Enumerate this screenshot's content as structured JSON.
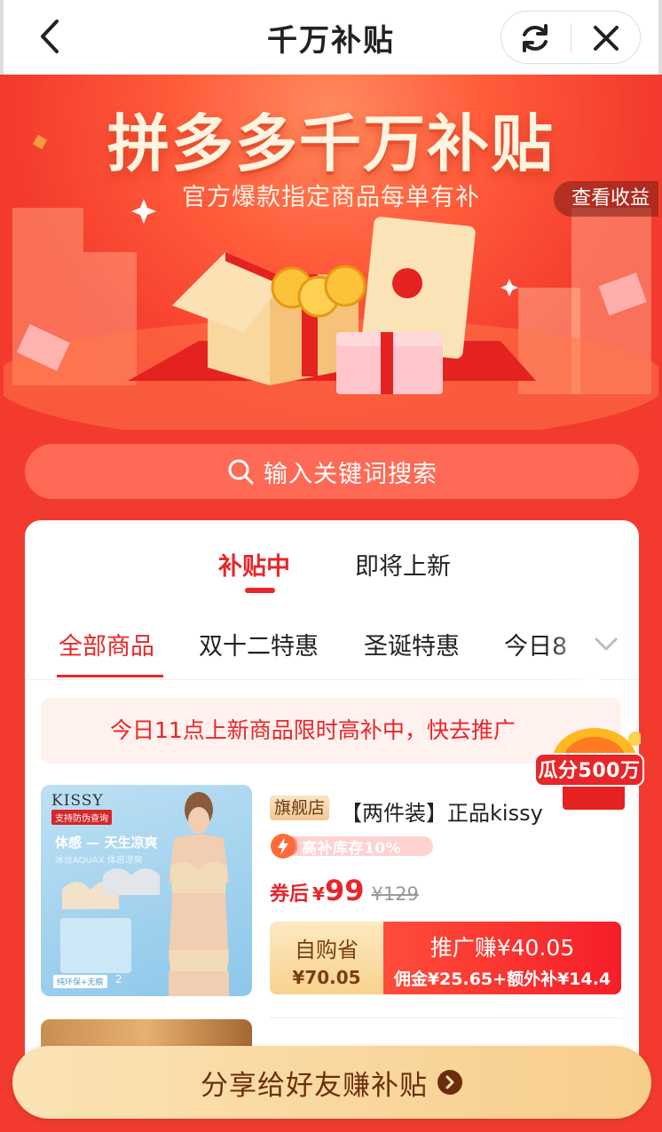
{
  "nav": {
    "title": "千万补贴"
  },
  "hero": {
    "title": "拼多多千万补贴",
    "subtitle": "官方爆款指定商品每单有补",
    "earnings_label": "查看收益"
  },
  "search": {
    "placeholder": "输入关键词搜索"
  },
  "main_tabs": [
    {
      "label": "补贴中",
      "active": true
    },
    {
      "label": "即将上新",
      "active": false
    }
  ],
  "categories": [
    {
      "label": "全部商品",
      "active": true
    },
    {
      "label": "双十二特惠",
      "active": false
    },
    {
      "label": "圣诞特惠",
      "active": false
    },
    {
      "label": "今日8",
      "active": false
    }
  ],
  "notice": {
    "text": "今日11点上新商品限时高补中，快去推广"
  },
  "badge": {
    "text": "瓜分500万"
  },
  "product": {
    "image_brand": "KISSY",
    "image_brand_tag": "支持防伪查询",
    "image_slogan": "体感 — 天生凉爽",
    "image_slogan_sub": "冰丝AQUAX 体感凉爽",
    "image_tag": "纯环保+无痕",
    "image_count": "2",
    "shop_tag": "旗舰店",
    "title": "【两件装】正品kissy",
    "stock_label": "高补库存10%",
    "stock_fraction": 0.1,
    "price_prefix": "券后",
    "currency": "¥",
    "price": "99",
    "original_price": "¥129",
    "self_buy_label": "自购省",
    "self_buy_amount": "¥70.05",
    "promote_label": "推广赚¥40.05",
    "promote_detail": "佣金¥25.65+额外补¥14.4"
  },
  "share_button": {
    "label": "分享给好友赚补贴"
  },
  "colors": {
    "accent": "#e8262a",
    "background": "#f23b2e",
    "gold": "#f7cd8a"
  }
}
